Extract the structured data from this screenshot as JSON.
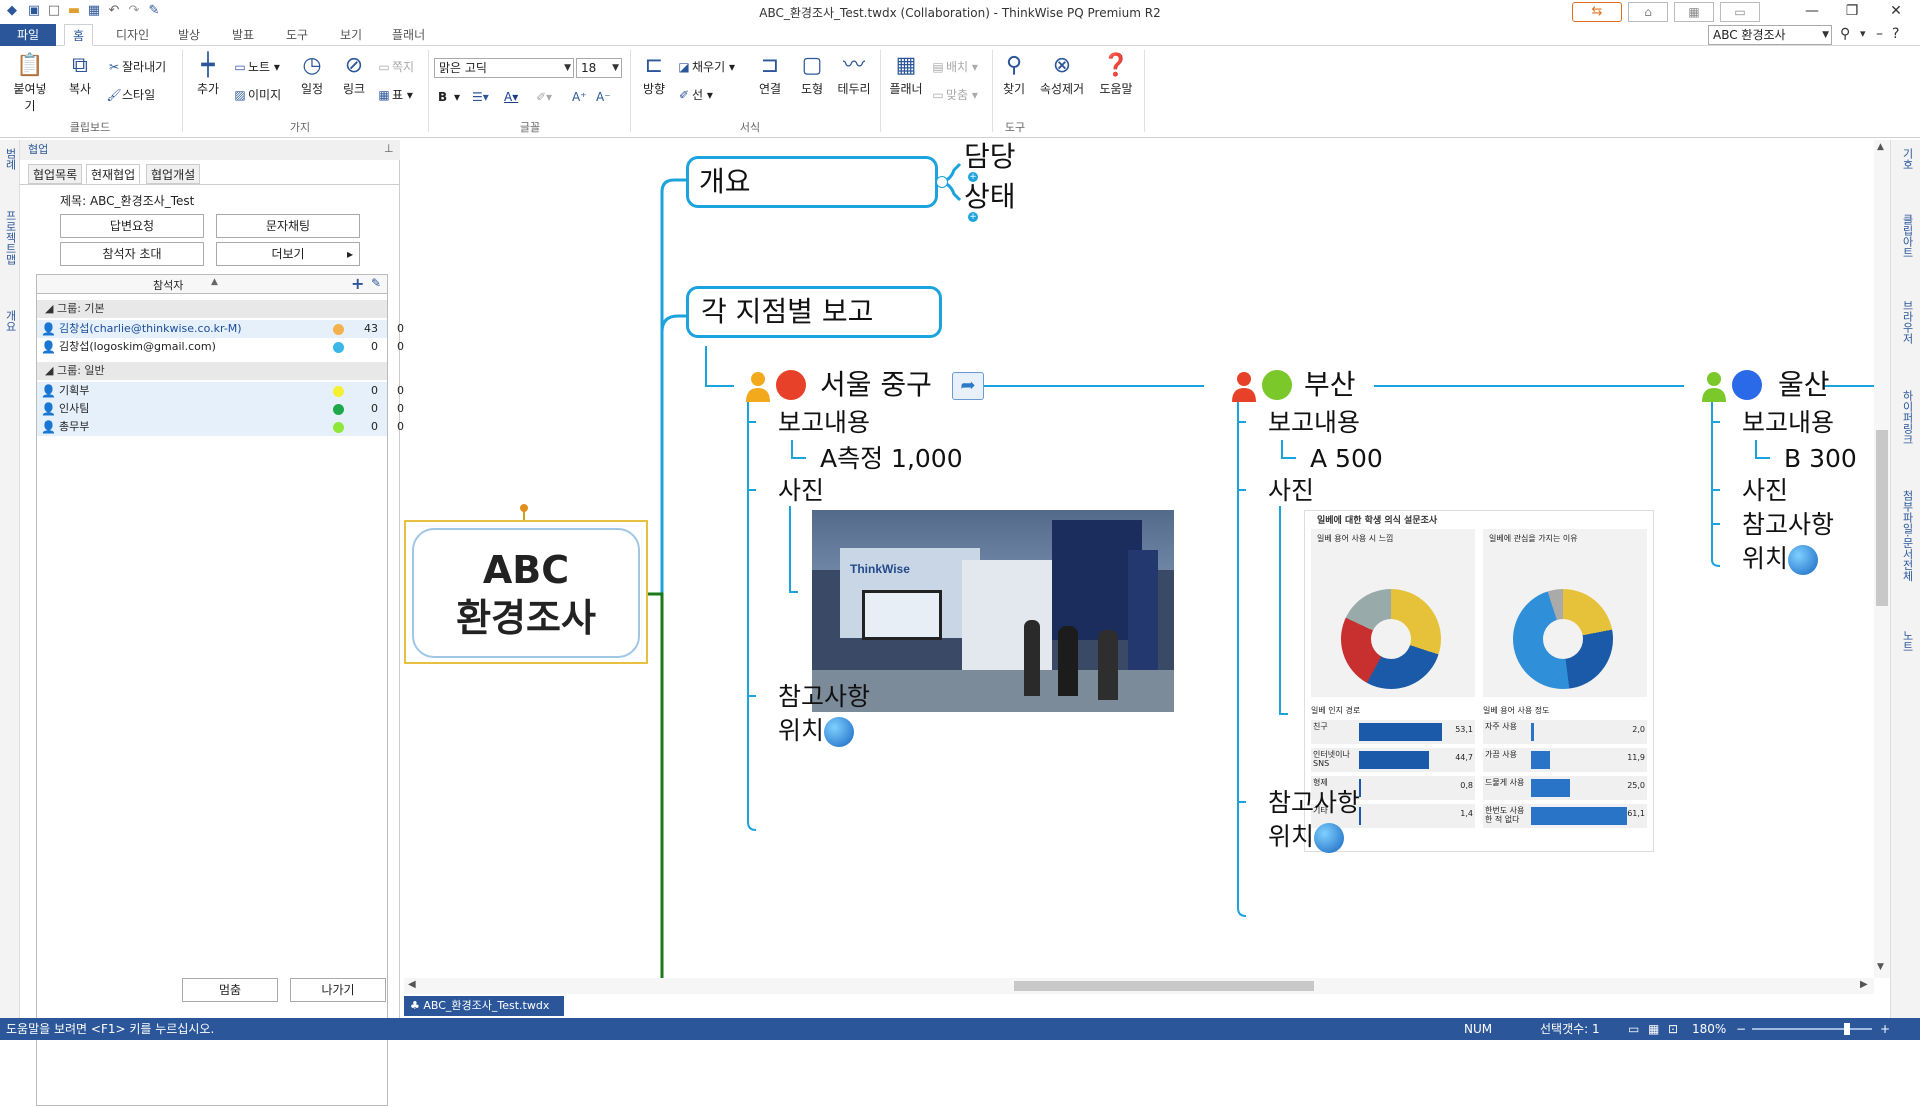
{
  "window": {
    "title": "ABC_환경조사_Test.twdx (Collaboration) - ThinkWise PQ Premium R2",
    "doc_selector": "ABC 환경조사"
  },
  "tabs": [
    "파일",
    "홈",
    "디자인",
    "발상",
    "발표",
    "도구",
    "보기",
    "플래너"
  ],
  "ribbon": {
    "clipboard": {
      "paste": "붙여넣기",
      "copy": "복사",
      "cut": "잘라내기",
      "style": "스타일",
      "label": "클립보드"
    },
    "branch": {
      "add": "추가",
      "note": "노트",
      "image": "이미지",
      "schedule": "일정",
      "link": "링크",
      "memo": "쪽지",
      "table": "표",
      "label": "가지"
    },
    "font": {
      "face": "맑은 고딕",
      "size": "18",
      "bold": "B",
      "label": "글꼴"
    },
    "format": {
      "direction": "방향",
      "fill": "채우기",
      "line": "선",
      "connect": "연결",
      "shape": "도형",
      "border": "테두리",
      "label": "서식"
    },
    "arrange": {
      "planner": "플래너",
      "arrange": "배치",
      "fit": "맞춤"
    },
    "tools": {
      "find": "찾기",
      "remove_attr": "속성제거",
      "help": "도움말",
      "label": "도구"
    }
  },
  "left_strip": [
    "범례",
    "프로젝트맵",
    "개요"
  ],
  "panel": {
    "header": "협업",
    "tabs": [
      "협업목록",
      "현재협업",
      "협업개설"
    ],
    "subject": "제목: ABC_환경조사_Test",
    "buttons": {
      "request": "답변요청",
      "chat": "문자채팅",
      "invite": "참석자 초대",
      "more": "더보기"
    },
    "list_header": "참석자",
    "group1": "그룹: 기본",
    "group2": "그룹: 일반",
    "users": [
      {
        "name": "김창섭(charlie@thinkwise.co.kr-M)",
        "color": "#f4b04a",
        "n1": "43",
        "n2": "0"
      },
      {
        "name": "김창섭(logoskim@gmail.com)",
        "color": "#3ab6e8",
        "n1": "0",
        "n2": "0"
      }
    ],
    "members": [
      {
        "name": "기획부",
        "color": "#f5f032",
        "n1": "0",
        "n2": "0"
      },
      {
        "name": "인사팀",
        "color": "#1ea84a",
        "n1": "0",
        "n2": "0"
      },
      {
        "name": "총무부",
        "color": "#8ee83a",
        "n1": "0",
        "n2": "0"
      }
    ],
    "bottom": {
      "stop": "멈춤",
      "leave": "나가기"
    }
  },
  "mindmap": {
    "root": [
      "ABC",
      "환경조사"
    ],
    "overview": "개요",
    "manager": "담당",
    "status": "상태",
    "branch_reports": "각 지점별 보고",
    "seoul": "서울 중구",
    "busan": "부산",
    "ulsan": "울산",
    "report": "보고내용",
    "photo": "사진",
    "ref": "참고사항",
    "location": "위치",
    "seoul_value": "A측정 1,000",
    "busan_value": "A 500",
    "ulsan_value": "B 300"
  },
  "survey": {
    "title": "일베에 대한 학생 의식 설문조사",
    "p1_title": "일베 용어 사용 시 느낌",
    "p2_title": "일베에 관심을 가지는 이유",
    "b1_title": "일베 인지 경로",
    "b2_title": "일베 용어 사용 정도",
    "b1": [
      {
        "label": "친구",
        "value": "53,1"
      },
      {
        "label": "인터넷이나 SNS",
        "value": "44,7"
      },
      {
        "label": "형제",
        "value": "0,8"
      },
      {
        "label": "기타",
        "value": "1,4"
      }
    ],
    "b2": [
      {
        "label": "자주 사용",
        "value": "2,0"
      },
      {
        "label": "가끔 사용",
        "value": "11,9"
      },
      {
        "label": "드물게 사용",
        "value": "25,0"
      },
      {
        "label": "한번도 사용한 적 없다",
        "value": "61,1"
      }
    ]
  },
  "photo_text": {
    "sign": "ThinkWise"
  },
  "doctab": "ABC_환경조사_Test.twdx",
  "status": {
    "help": "도움말을 보려면 <F1> 키를 누르십시오.",
    "num": "NUM",
    "selected": "선택갯수: 1",
    "zoom": "180%"
  },
  "right_strip": [
    "기호",
    "클립아트",
    "브라우저",
    "하이퍼링크",
    "첨부파일·문서전체",
    "노트"
  ],
  "colors": {
    "accent": "#2b579a",
    "branch": "#1aa3dd",
    "root_line": "#1a7a1a"
  }
}
